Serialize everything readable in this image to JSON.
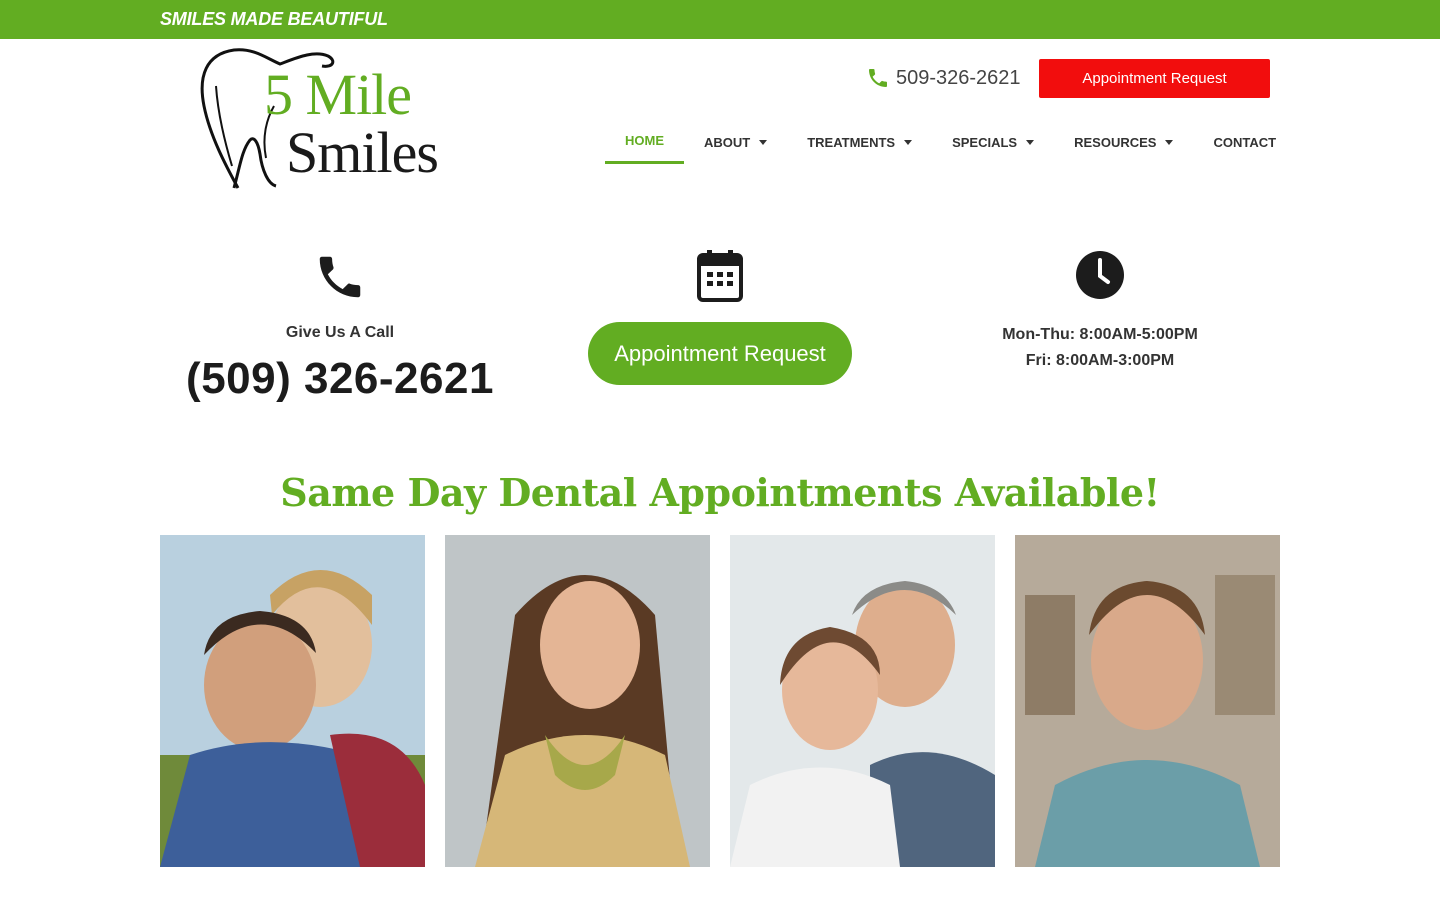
{
  "topbar": {
    "tagline": "SMILES MADE BEAUTIFUL"
  },
  "logo": {
    "line1": "5 Mile",
    "line2": "Smiles"
  },
  "header": {
    "phone": "509-326-2621",
    "appointment_button": "Appointment Request"
  },
  "nav": {
    "items": [
      {
        "label": "HOME",
        "active": true,
        "dropdown": false
      },
      {
        "label": "ABOUT",
        "dropdown": true
      },
      {
        "label": "TREATMENTS",
        "dropdown": true
      },
      {
        "label": "SPECIALS",
        "dropdown": true
      },
      {
        "label": "RESOURCES",
        "dropdown": true
      },
      {
        "label": "CONTACT",
        "dropdown": false
      }
    ]
  },
  "info": {
    "call_label": "Give Us A Call",
    "call_number": "(509) 326-2621",
    "appointment_button": "Appointment Request",
    "hours": [
      "Mon-Thu: 8:00AM-5:00PM",
      "Fri: 8:00AM-3:00PM"
    ]
  },
  "headline": "Same Day Dental Appointments Available!",
  "icons": [
    "phone-icon",
    "calendar-icon",
    "clock-icon"
  ],
  "colors": {
    "brand_green": "#62ad22",
    "cta_red": "#f20d0d"
  }
}
